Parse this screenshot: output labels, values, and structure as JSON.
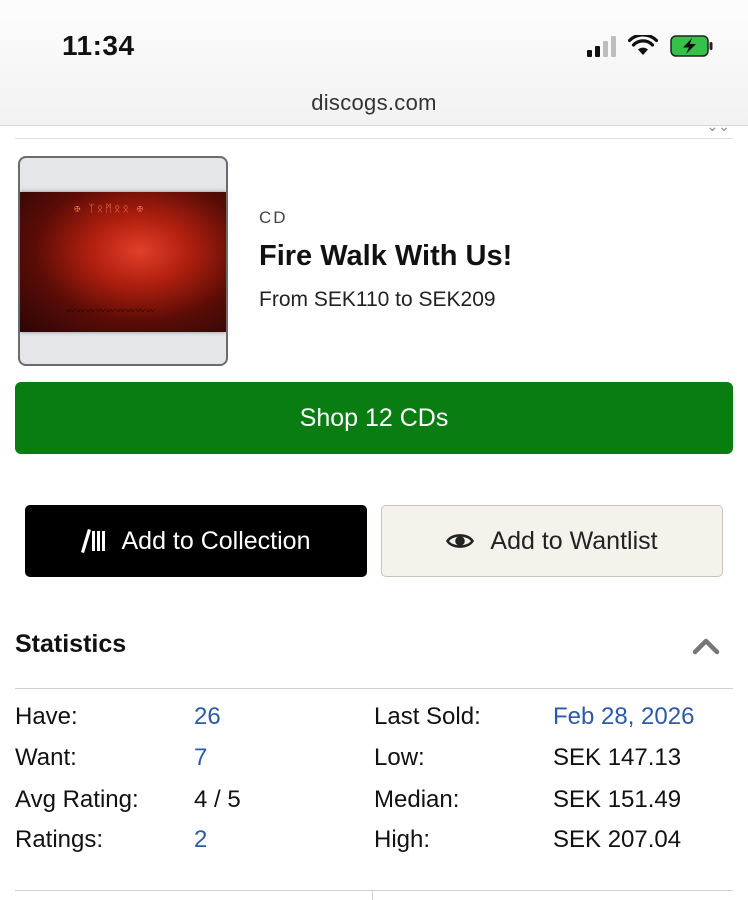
{
  "status_bar": {
    "time": "11:34",
    "url": "discogs.com"
  },
  "release": {
    "format": "CD",
    "title": "Fire Walk With Us!",
    "price_range": "From SEK110 to SEK209"
  },
  "actions": {
    "shop_label": "Shop 12 CDs",
    "collection_label": "Add to Collection",
    "wantlist_label": "Add to Wantlist"
  },
  "statistics": {
    "heading": "Statistics",
    "left": [
      {
        "label": "Have:",
        "value": "26"
      },
      {
        "label": "Want:",
        "value": "7"
      },
      {
        "label": "Avg Rating:",
        "value": "4 / 5"
      },
      {
        "label": "Ratings:",
        "value": "2"
      }
    ],
    "right": [
      {
        "label": "Last Sold:",
        "value": "Feb 28, 2026"
      },
      {
        "label": "Low:",
        "value": "SEK 147.13"
      },
      {
        "label": "Median:",
        "value": "SEK 151.49"
      },
      {
        "label": "High:",
        "value": "SEK 207.04"
      }
    ]
  },
  "colors": {
    "shop_green": "#0a7d12",
    "link_blue": "#2d5aa8"
  }
}
